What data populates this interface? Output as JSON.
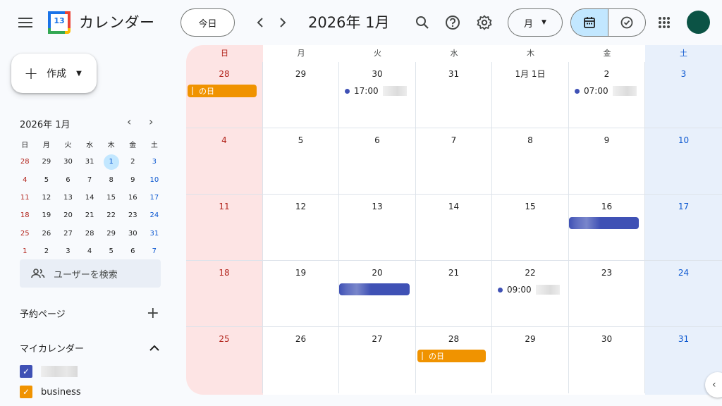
{
  "header": {
    "app_title": "カレンダー",
    "logo_day": "13",
    "today_label": "今日",
    "month_title": "2026年 1月",
    "view_label": "月"
  },
  "sidebar": {
    "create_label": "作成",
    "mini": {
      "title": "2026年 1月",
      "weekdays": [
        "日",
        "月",
        "火",
        "水",
        "木",
        "金",
        "土"
      ],
      "weeks": [
        [
          "28",
          "29",
          "30",
          "31",
          "1",
          "2",
          "3"
        ],
        [
          "4",
          "5",
          "6",
          "7",
          "8",
          "9",
          "10"
        ],
        [
          "11",
          "12",
          "13",
          "14",
          "15",
          "16",
          "17"
        ],
        [
          "18",
          "19",
          "20",
          "21",
          "22",
          "23",
          "24"
        ],
        [
          "25",
          "26",
          "27",
          "28",
          "29",
          "30",
          "31"
        ],
        [
          "1",
          "2",
          "3",
          "4",
          "5",
          "6",
          "7"
        ]
      ],
      "today": "1"
    },
    "people_search_placeholder": "ユーザーを検索",
    "booking_label": "予約ページ",
    "my_calendars_label": "マイカレンダー",
    "calendars": [
      {
        "name": "",
        "color": "#3f51b5"
      },
      {
        "name": "business",
        "color": "#f09300"
      }
    ]
  },
  "calendar": {
    "weekdays": [
      "日",
      "月",
      "火",
      "水",
      "木",
      "金",
      "土"
    ],
    "weeks": [
      [
        "28",
        "29",
        "30",
        "31",
        "1月 1日",
        "2",
        "3"
      ],
      [
        "4",
        "5",
        "6",
        "7",
        "8",
        "9",
        "10"
      ],
      [
        "11",
        "12",
        "13",
        "14",
        "15",
        "16",
        "17"
      ],
      [
        "18",
        "19",
        "20",
        "21",
        "22",
        "23",
        "24"
      ],
      [
        "25",
        "26",
        "27",
        "28",
        "29",
        "30",
        "31"
      ]
    ],
    "events": {
      "w0_sun_allday": "の日",
      "w0_tue_time": "17:00",
      "w0_fri_time": "07:00",
      "w3_thu_time": "09:00",
      "w4_wed_allday": "の日"
    }
  },
  "colors": {
    "accent": "#0b57d0",
    "sunday": "#b3261e",
    "event_blue": "#3f51b5",
    "event_orange": "#f09300"
  }
}
